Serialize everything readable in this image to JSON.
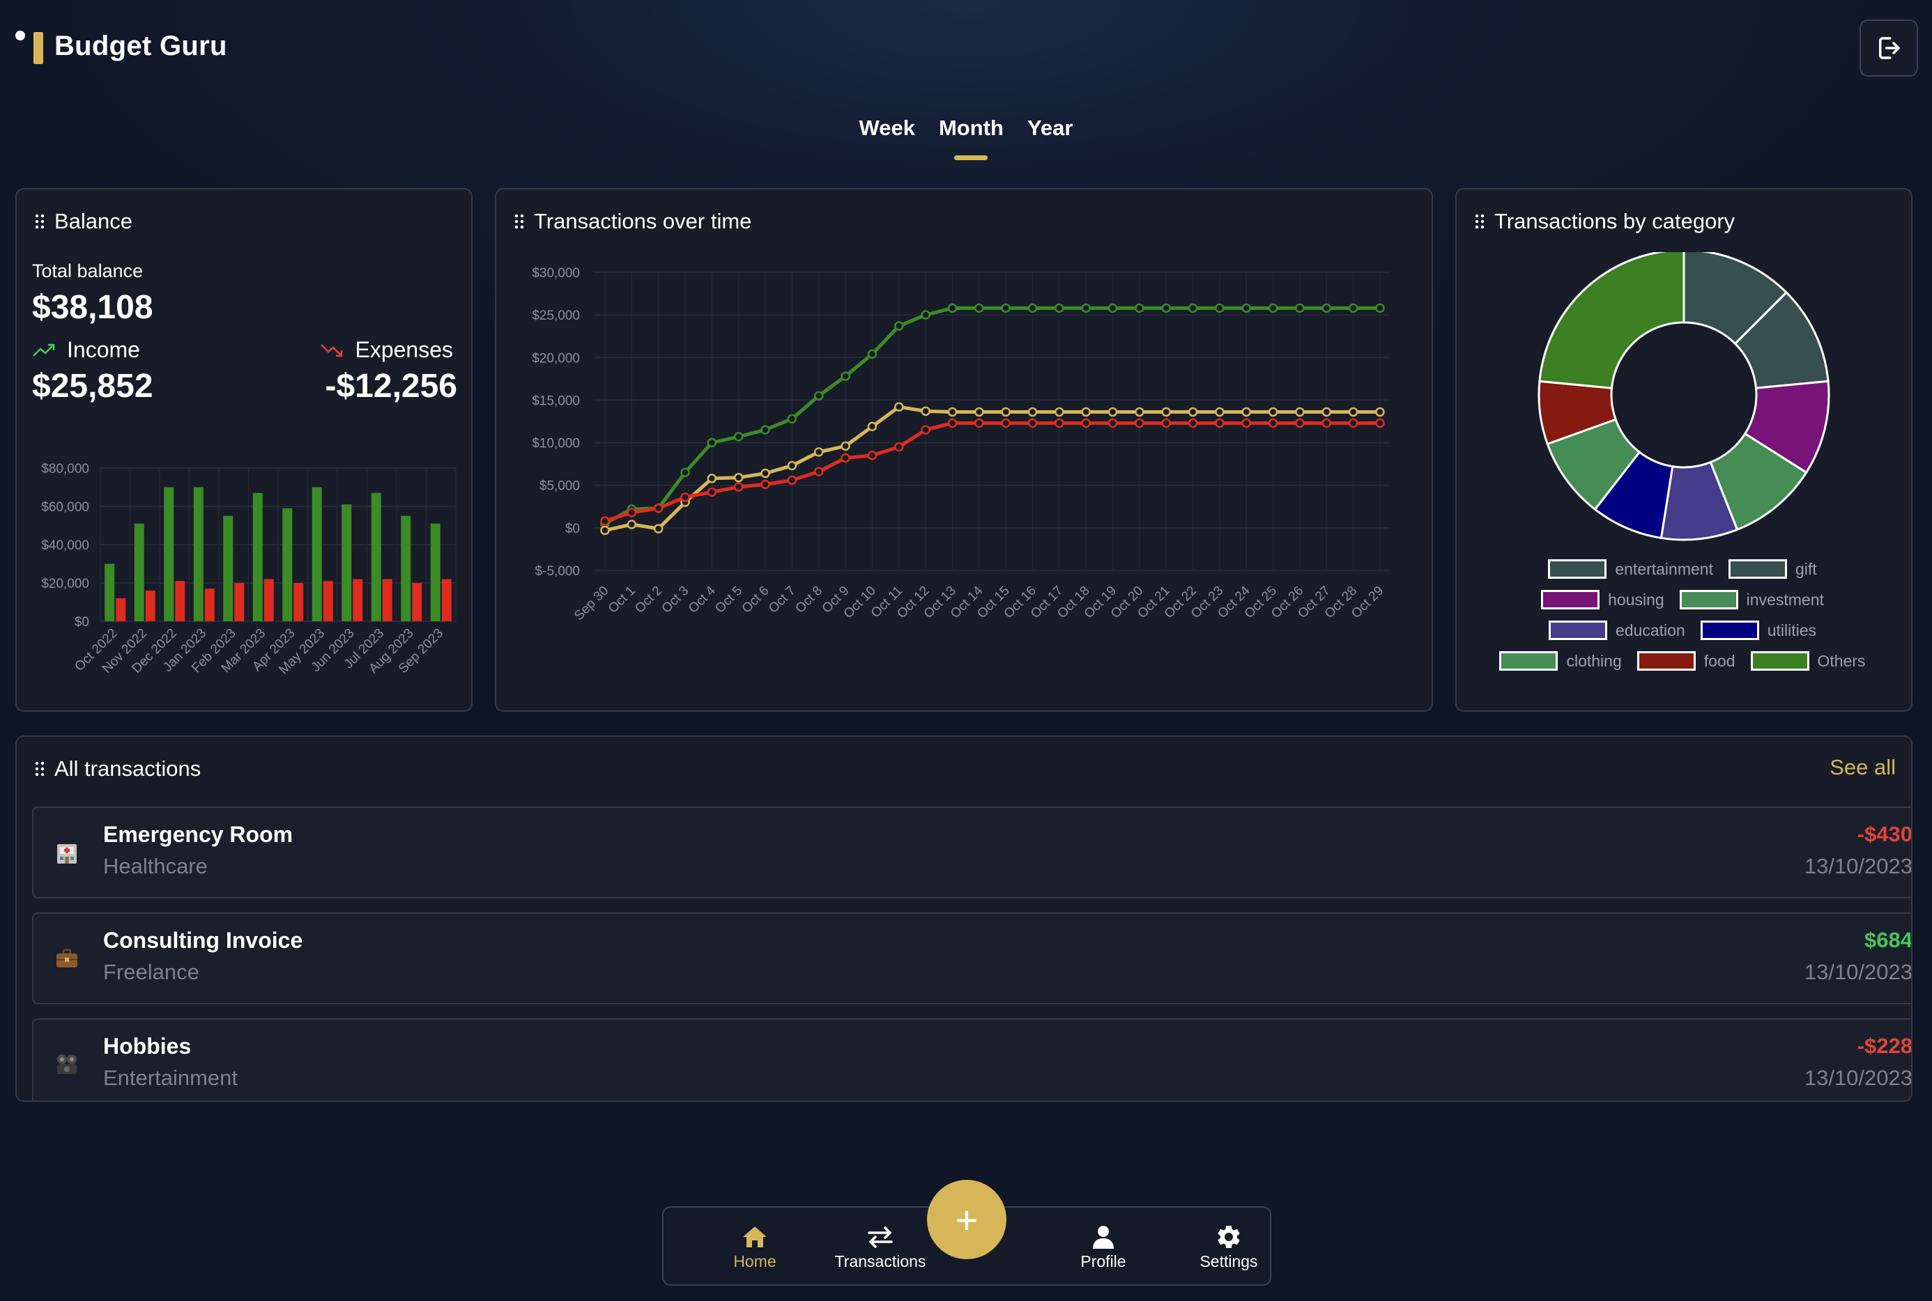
{
  "app": {
    "title": "Budget Guru"
  },
  "period_tabs": [
    {
      "label": "Week",
      "active": false
    },
    {
      "label": "Month",
      "active": true
    },
    {
      "label": "Year",
      "active": false
    }
  ],
  "balance": {
    "title": "Balance",
    "total_label": "Total balance",
    "total_value": "$38,108",
    "income_label": "Income",
    "income_value": "$25,852",
    "expenses_label": "Expenses",
    "expenses_value": "-$12,256"
  },
  "transactions_over_time": {
    "title": "Transactions over time"
  },
  "transactions_by_category": {
    "title": "Transactions by category"
  },
  "chart_data": [
    {
      "type": "bar",
      "categories": [
        "Oct 2022",
        "Nov 2022",
        "Dec 2022",
        "Jan 2023",
        "Feb 2023",
        "Mar 2023",
        "Apr 2023",
        "May 2023",
        "Jun 2023",
        "Jul 2023",
        "Aug 2023",
        "Sep 2023"
      ],
      "series": [
        {
          "color": "#3c8c25",
          "values": [
            30000,
            51000,
            70000,
            70000,
            55000,
            67000,
            59000,
            70000,
            61000,
            67000,
            55000,
            51000
          ]
        },
        {
          "color": "#e02b1f",
          "values": [
            12000,
            16000,
            21000,
            17000,
            20000,
            22000,
            20000,
            21000,
            22000,
            22000,
            20000,
            22000
          ]
        }
      ],
      "ylim": [
        0,
        80000
      ],
      "yticks": [
        "$80,000",
        "$60,000",
        "$40,000",
        "$20,000",
        "$0"
      ],
      "grid": true
    },
    {
      "type": "line",
      "x": [
        "Sep 30",
        "Oct 1",
        "Oct 2",
        "Oct 3",
        "Oct 4",
        "Oct 5",
        "Oct 6",
        "Oct 7",
        "Oct 8",
        "Oct 9",
        "Oct 10",
        "Oct 11",
        "Oct 12",
        "Oct 13",
        "Oct 14",
        "Oct 15",
        "Oct 16",
        "Oct 17",
        "Oct 18",
        "Oct 19",
        "Oct 20",
        "Oct 21",
        "Oct 22",
        "Oct 23",
        "Oct 24",
        "Oct 25",
        "Oct 26",
        "Oct 27",
        "Oct 28",
        "Oct 29"
      ],
      "series": [
        {
          "color": "#3c8c25",
          "values": [
            500,
            2200,
            2300,
            6500,
            10000,
            10700,
            11500,
            12800,
            15500,
            17800,
            20400,
            23700,
            25000,
            25800,
            25800,
            25800,
            25800,
            25800,
            25800,
            25800,
            25800,
            25800,
            25800,
            25800,
            25800,
            25800,
            25800,
            25800,
            25800,
            25800
          ]
        },
        {
          "color": "#d7b65a",
          "values": [
            -300,
            400,
            -100,
            3000,
            5800,
            5900,
            6400,
            7300,
            8900,
            9600,
            11900,
            14200,
            13700,
            13600,
            13600,
            13600,
            13600,
            13600,
            13600,
            13600,
            13600,
            13600,
            13600,
            13600,
            13600,
            13600,
            13600,
            13600,
            13600,
            13600
          ]
        },
        {
          "color": "#e02b1f",
          "values": [
            800,
            1800,
            2300,
            3600,
            4200,
            4800,
            5100,
            5600,
            6600,
            8200,
            8500,
            9500,
            11500,
            12300,
            12300,
            12300,
            12300,
            12300,
            12300,
            12300,
            12300,
            12300,
            12300,
            12300,
            12300,
            12300,
            12300,
            12300,
            12300,
            12300
          ]
        }
      ],
      "ylim": [
        -5000,
        30000
      ],
      "yticks": [
        "$30,000",
        "$25,000",
        "$20,000",
        "$15,000",
        "$10,000",
        "$5,000",
        "$0",
        "$-5,000"
      ],
      "grid": true
    },
    {
      "type": "pie",
      "donut": true,
      "labels": [
        "entertainment",
        "gift",
        "housing",
        "investment",
        "education",
        "utilities",
        "clothing",
        "food",
        "Others"
      ],
      "values": [
        12.5,
        11,
        10.5,
        10,
        8.5,
        8,
        9,
        7,
        23.5
      ],
      "colors": [
        "#37504f",
        "#37504f",
        "#781478",
        "#468c55",
        "#463c8c",
        "#000080",
        "#468c55",
        "#841a10",
        "#3c8023"
      ],
      "legend": "bottom"
    }
  ],
  "all_transactions": {
    "title": "All transactions",
    "see_all": "See all",
    "items": [
      {
        "icon": "hospital-icon",
        "name": "Emergency Room",
        "category": "Healthcare",
        "amount": "-$430",
        "date": "13/10/2023",
        "amount_color": "#e0443c"
      },
      {
        "icon": "briefcase-icon",
        "name": "Consulting Invoice",
        "category": "Freelance",
        "amount": "$684",
        "date": "13/10/2023",
        "amount_color": "#4cc25a"
      },
      {
        "icon": "hobbies-icon",
        "name": "Hobbies",
        "category": "Entertainment",
        "amount": "-$228",
        "date": "13/10/2023",
        "amount_color": "#e0443c"
      }
    ]
  },
  "bottom_nav": {
    "items": [
      {
        "label": "Home",
        "icon": "home-icon",
        "active": true
      },
      {
        "label": "Transactions",
        "icon": "swap-icon",
        "active": false
      },
      {
        "label": "Profile",
        "icon": "person-icon",
        "active": false
      },
      {
        "label": "Settings",
        "icon": "gear-icon",
        "active": false
      }
    ],
    "add_label": "+"
  },
  "colors": {
    "accent": "#d7b65a",
    "income": "#3c8c25",
    "expense": "#e02b1f",
    "net": "#d7b65a"
  }
}
